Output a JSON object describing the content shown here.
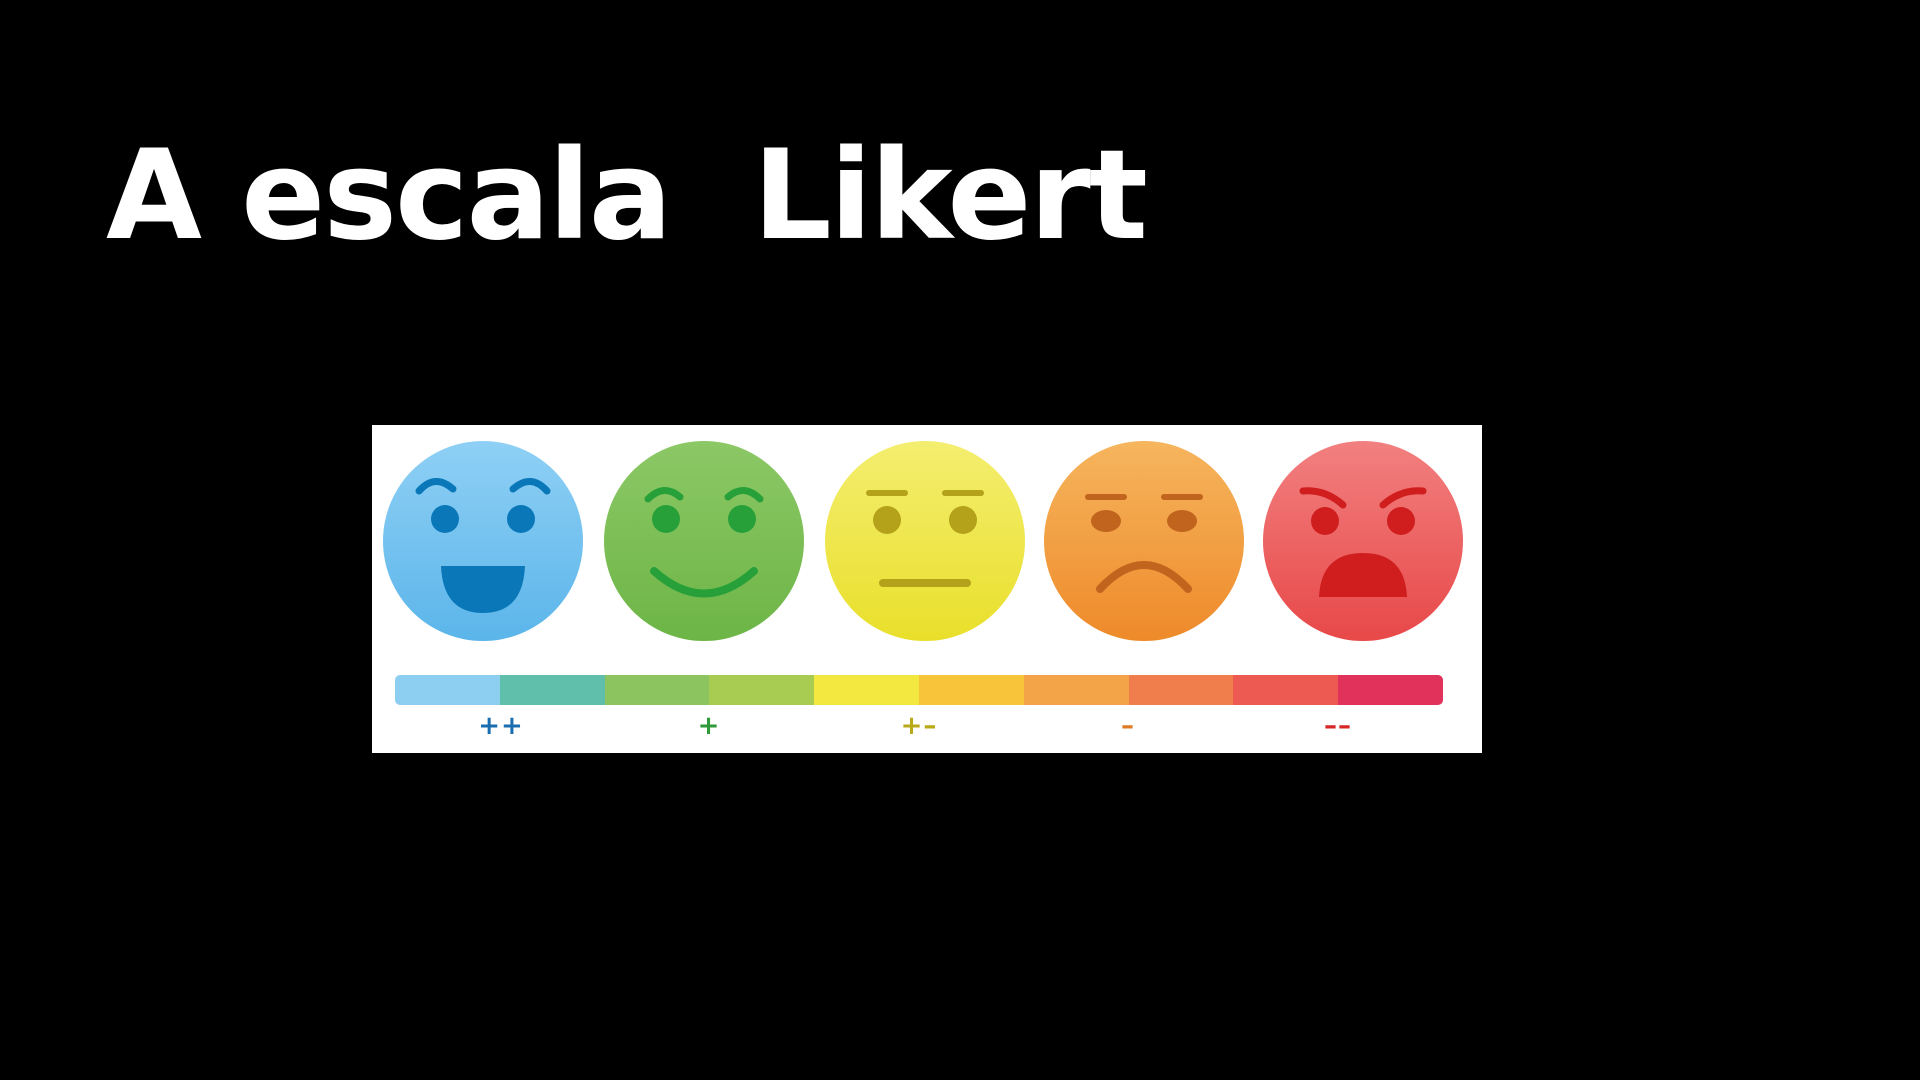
{
  "slide": {
    "title": "A escala  Likert"
  },
  "scale": {
    "levels": [
      {
        "label": "++",
        "face": "very-happy-face",
        "fill": "#8fd0f5",
        "fill_dark": "#5bb5ea",
        "feature": "#0a78b8"
      },
      {
        "label": "+",
        "face": "happy-face",
        "fill": "#8cc866",
        "fill_dark": "#6db546",
        "feature": "#27a03a"
      },
      {
        "label": "+–",
        "face": "neutral-face",
        "fill": "#f4ee70",
        "fill_dark": "#e9df2a",
        "feature": "#b3a21a"
      },
      {
        "label": "–",
        "face": "sad-face",
        "fill": "#f6b55e",
        "fill_dark": "#ee8a2a",
        "feature": "#c0641e"
      },
      {
        "label": "––",
        "face": "angry-face",
        "fill": "#f28080",
        "fill_dark": "#e84848",
        "feature": "#d01e1e"
      }
    ],
    "bar_colors": [
      "#8ccff0",
      "#5fbfaa",
      "#8cc460",
      "#a8cc52",
      "#f2e840",
      "#f8c43a",
      "#f4a448",
      "#ef7e4c",
      "#ec5a52",
      "#e0325a"
    ],
    "label_colors": [
      "#1a6eb0",
      "#2e9a3a",
      "#b8aa18",
      "#e07a24",
      "#d82626"
    ]
  }
}
